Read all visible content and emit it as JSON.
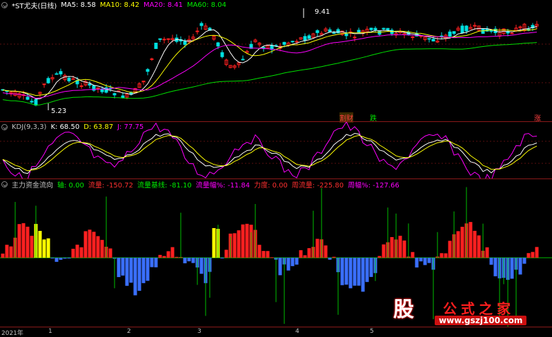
{
  "colors": {
    "up": "#ff2020",
    "down": "#00e0e0",
    "ma5": "#ffffff",
    "ma10": "#ffff00",
    "ma20": "#ff00ff",
    "ma60": "#00e000",
    "kdj_k": "#ffffff",
    "kdj_d": "#ffff00",
    "kdj_j": "#ff00ff",
    "flow_pos": "#ff2020",
    "flow_neg": "#3a6fff",
    "flow_yellow": "#ffff00",
    "flow_line": "#00c000"
  },
  "main_panel": {
    "legend": {
      "stock_name": "*ST尤夫(日线)",
      "ma5_label": "MA5:",
      "ma5_value": "8.58",
      "ma10_label": "MA10:",
      "ma10_value": "8.42",
      "ma20_label": "MA20:",
      "ma20_value": "8.41",
      "ma60_label": "MA60:",
      "ma60_value": "8.04"
    },
    "high_label": "9.41",
    "low_label": "5.23",
    "tags": [
      {
        "text": "割财",
        "color": "#ff4040"
      },
      {
        "text": "跌",
        "color": "#00e000"
      },
      {
        "text": "涨",
        "color": "#ff4040"
      }
    ]
  },
  "kdj_panel": {
    "legend": {
      "name": "KDJ(9,3,3)",
      "k": "K: 68.50",
      "d": "D: 63.87",
      "j": "J: 77.75"
    }
  },
  "flow_panel": {
    "legend": {
      "name": "主力资金流向",
      "axis": "轴: 0.00",
      "flow": "流量: -150.72",
      "baseline": "流量基线: -81.10",
      "flow_pct": "流量幅%: -11.84",
      "power": "力度: 0.00",
      "week_flow": "周流量: -225.80",
      "week_pct": "周幅%: -127.66"
    }
  },
  "time_axis": {
    "labels": [
      "2021年",
      "1",
      "2",
      "3",
      "4",
      "5"
    ]
  },
  "watermark": {
    "badge": "股",
    "title": "公式之家",
    "url": "www.gszj100.com"
  }
}
